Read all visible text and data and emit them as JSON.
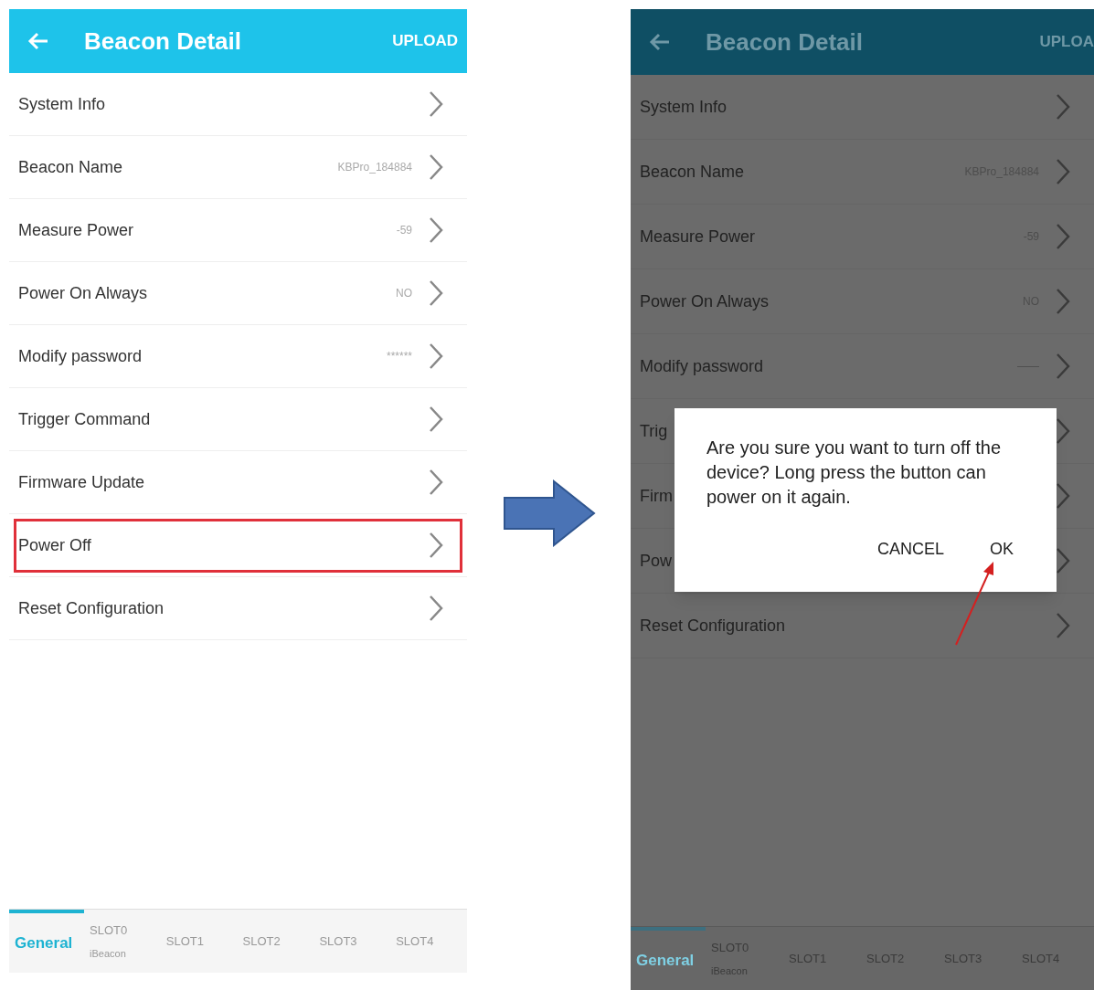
{
  "screens": [
    {
      "dimmed": false,
      "header": {
        "title": "Beacon Detail",
        "action": "UPLOAD"
      },
      "rows": [
        {
          "label": "System Info",
          "highlighted": false
        },
        {
          "label": "Beacon Name",
          "value": "KBPro_184884",
          "highlighted": false
        },
        {
          "label": "Measure Power",
          "value": "-59",
          "highlighted": false
        },
        {
          "label": "Power On Always",
          "value": "NO",
          "highlighted": false
        },
        {
          "label": "Modify password",
          "value": "******",
          "highlighted": false
        },
        {
          "label": "Trigger Command",
          "highlighted": false
        },
        {
          "label": "Firmware Update",
          "highlighted": false
        },
        {
          "label": "Power Off",
          "highlighted": true
        },
        {
          "label": "Reset Configuration",
          "highlighted": false
        }
      ],
      "tabs": [
        {
          "label": "General",
          "selected": true
        },
        {
          "label": "SLOT0",
          "sublabel": "iBeacon",
          "selected": false
        },
        {
          "label": "SLOT1",
          "selected": false
        },
        {
          "label": "SLOT2",
          "selected": false
        },
        {
          "label": "SLOT3",
          "selected": false
        },
        {
          "label": "SLOT4",
          "selected": false
        }
      ]
    },
    {
      "dimmed": true,
      "header": {
        "title": "Beacon Detail",
        "action": "UPLOA"
      },
      "rows": [
        {
          "label": "System Info",
          "highlighted": false
        },
        {
          "label": "Beacon Name",
          "value": "KBPro_184884",
          "highlighted": false
        },
        {
          "label": "Measure Power",
          "value": "-59",
          "highlighted": false
        },
        {
          "label": "Power On Always",
          "value": "NO",
          "highlighted": false
        },
        {
          "label": "Modify password",
          "value": "——",
          "highlighted": false
        },
        {
          "label": "Trig",
          "highlighted": false
        },
        {
          "label": "Firm",
          "highlighted": false
        },
        {
          "label": "Pow",
          "highlighted": false
        },
        {
          "label": "Reset Configuration",
          "highlighted": false
        }
      ],
      "dialog": {
        "message": "Are you sure you want to turn off the device? Long press the button can power on it again.",
        "buttons": [
          "CANCEL",
          "OK"
        ]
      },
      "annotation_arrow": true,
      "tabs": [
        {
          "label": "General",
          "selected": true
        },
        {
          "label": "SLOT0",
          "sublabel": "iBeacon",
          "selected": false
        },
        {
          "label": "SLOT1",
          "selected": false
        },
        {
          "label": "SLOT2",
          "selected": false
        },
        {
          "label": "SLOT3",
          "selected": false
        },
        {
          "label": "SLOT4",
          "selected": false
        }
      ]
    }
  ]
}
